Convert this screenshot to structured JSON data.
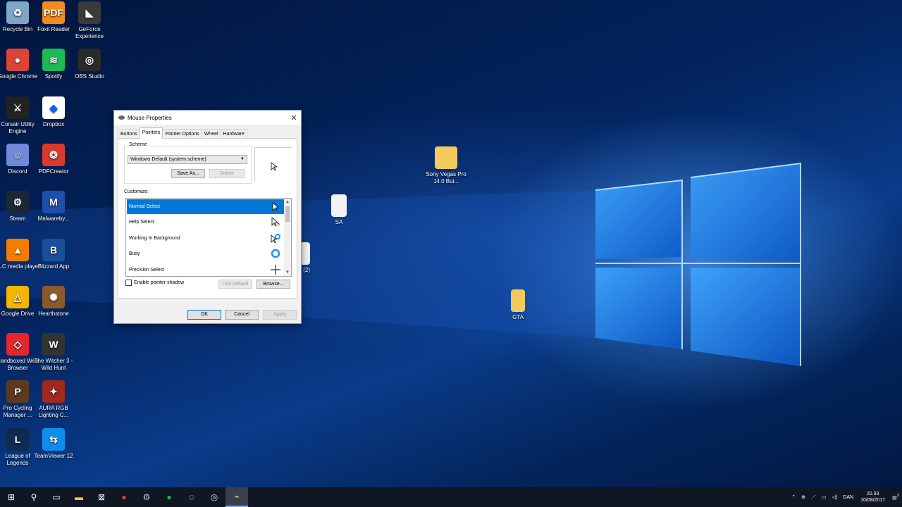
{
  "desktop": {
    "icons": [
      {
        "label": "Recycle Bin",
        "color": "#7fa5c8",
        "glyph": "♻"
      },
      {
        "label": "Foxit Reader",
        "color": "#f28c1c",
        "glyph": "PDF"
      },
      {
        "label": "GeForce Experience",
        "color": "#3a3a3a",
        "glyph": "◣"
      },
      {
        "label": "Google Chrome",
        "color": "#db4437",
        "glyph": "●"
      },
      {
        "label": "Spotify",
        "color": "#1db954",
        "glyph": "≋"
      },
      {
        "label": "OBS Studio",
        "color": "#2b2b2b",
        "glyph": "◎"
      },
      {
        "label": "Corsair Utility Engine",
        "color": "#222222",
        "glyph": "⚔"
      },
      {
        "label": "Dropbox",
        "color": "#ffffff",
        "glyph": "◆"
      },
      {
        "label": "Discord",
        "color": "#7289da",
        "glyph": "☺"
      },
      {
        "label": "PDFCreator",
        "color": "#d93a2b",
        "glyph": "❂"
      },
      {
        "label": "Steam",
        "color": "#1b2838",
        "glyph": "⚙"
      },
      {
        "label": "Malwareby...",
        "color": "#1f4fa8",
        "glyph": "M"
      },
      {
        "label": "VLC media player",
        "color": "#f47c00",
        "glyph": "▲"
      },
      {
        "label": "Blizzard App",
        "color": "#1b4f9a",
        "glyph": "B"
      },
      {
        "label": "Google Drive",
        "color": "#f4b400",
        "glyph": "△"
      },
      {
        "label": "Hearthstone",
        "color": "#8a5a2a",
        "glyph": "✺"
      },
      {
        "label": "Sandboxed Web Browser",
        "color": "#e5262b",
        "glyph": "◇"
      },
      {
        "label": "The Witcher 3 - Wild Hunt",
        "color": "#333333",
        "glyph": "W"
      },
      {
        "label": "Pro Cycling Manager ...",
        "color": "#5c3a1f",
        "glyph": "P"
      },
      {
        "label": "AURA RGB Lighting C...",
        "color": "#a0281f",
        "glyph": "✦"
      },
      {
        "label": "League of Legends",
        "color": "#0e2a52",
        "glyph": "L"
      },
      {
        "label": "TeamViewer 12",
        "color": "#0e8ee9",
        "glyph": "⇆"
      }
    ],
    "files": [
      {
        "label": "Sony Vegas Pro 14.0 Bui..."
      },
      {
        "label": "SA"
      },
      {
        "label": "(2)"
      },
      {
        "label": "GTA"
      }
    ]
  },
  "dialog": {
    "title": "Mouse Properties",
    "close": "✕",
    "tabs": [
      "Buttons",
      "Pointers",
      "Pointer Options",
      "Wheel",
      "Hardware"
    ],
    "active_tab": "Pointers",
    "scheme_label": "Scheme",
    "scheme_value": "Windows Default (system scheme)",
    "save_as": "Save As...",
    "delete": "Delete",
    "customize_label": "Customize:",
    "pointers": [
      {
        "name": "Normal Select",
        "selected": true
      },
      {
        "name": "Help Select",
        "selected": false
      },
      {
        "name": "Working In Background",
        "selected": false
      },
      {
        "name": "Busy",
        "selected": false
      },
      {
        "name": "Precision Select",
        "selected": false
      }
    ],
    "shadow_label": "Enable pointer shadow",
    "use_default": "Use Default",
    "browse": "Browse...",
    "ok": "OK",
    "cancel": "Cancel",
    "apply": "Apply"
  },
  "taskbar": {
    "apps": [
      {
        "name": "start-icon",
        "glyph": "⊞",
        "color": "#ffffff"
      },
      {
        "name": "search-icon",
        "glyph": "⚲",
        "color": "#ffffff"
      },
      {
        "name": "task-view-icon",
        "glyph": "▭",
        "color": "#ffffff"
      },
      {
        "name": "file-explorer-icon",
        "glyph": "▬",
        "color": "#f5c542"
      },
      {
        "name": "store-icon",
        "glyph": "⊠",
        "color": "#ffffff"
      },
      {
        "name": "chrome-icon",
        "glyph": "●",
        "color": "#db4437"
      },
      {
        "name": "steam-icon",
        "glyph": "⚙",
        "color": "#c6d4df"
      },
      {
        "name": "spotify-icon",
        "glyph": "●",
        "color": "#1db954"
      },
      {
        "name": "discord-icon",
        "glyph": "☺",
        "color": "#7289da"
      },
      {
        "name": "obs-icon",
        "glyph": "◎",
        "color": "#dddddd"
      },
      {
        "name": "mouse-properties-icon",
        "glyph": "⌁",
        "color": "#dddddd"
      }
    ],
    "lang": "DAN",
    "time": "20.33",
    "date": "10/08/2017",
    "notification_count": "3"
  }
}
